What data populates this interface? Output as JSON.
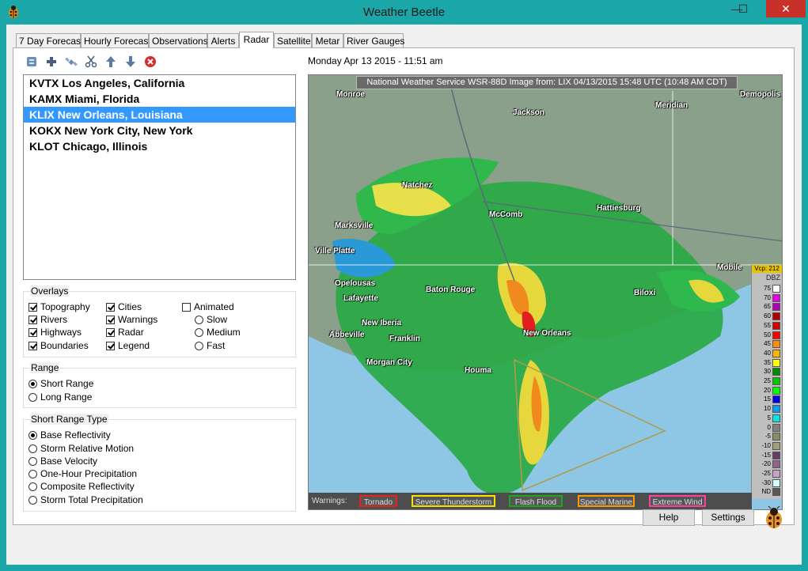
{
  "window": {
    "title": "Weather Beetle",
    "controls": {
      "minimize": "—",
      "maximize": "☐",
      "close": "✕"
    }
  },
  "tabs": [
    {
      "label": "7 Day Forecast"
    },
    {
      "label": "Hourly Forecast"
    },
    {
      "label": "Observations"
    },
    {
      "label": "Alerts"
    },
    {
      "label": "Radar"
    },
    {
      "label": "Satellite"
    },
    {
      "label": "Metar"
    },
    {
      "label": "River Gauges"
    }
  ],
  "active_tab": "Radar",
  "toolbar": [
    "refresh-icon",
    "add-icon",
    "satellite-icon",
    "cut-icon",
    "arrow-up-icon",
    "arrow-down-icon",
    "delete-icon"
  ],
  "stations": [
    {
      "label": "KVTX Los Angeles, California",
      "selected": false
    },
    {
      "label": "KAMX Miami, Florida",
      "selected": false
    },
    {
      "label": "KLIX New Orleans, Louisiana",
      "selected": true
    },
    {
      "label": "KOKX New York City, New York",
      "selected": false
    },
    {
      "label": "KLOT Chicago, Illinois",
      "selected": false
    }
  ],
  "overlays": {
    "title": "Overlays",
    "items": [
      {
        "label": "Topography",
        "checked": true
      },
      {
        "label": "Rivers",
        "checked": true
      },
      {
        "label": "Highways",
        "checked": true
      },
      {
        "label": "Boundaries",
        "checked": true
      },
      {
        "label": "Cities",
        "checked": true
      },
      {
        "label": "Warnings",
        "checked": true
      },
      {
        "label": "Radar",
        "checked": true
      },
      {
        "label": "Legend",
        "checked": true
      },
      {
        "label": "Animated",
        "checked": false
      }
    ],
    "speed": [
      {
        "label": "Slow",
        "checked": false
      },
      {
        "label": "Medium",
        "checked": false
      },
      {
        "label": "Fast",
        "checked": false
      }
    ]
  },
  "range": {
    "title": "Range",
    "options": [
      {
        "label": "Short Range",
        "checked": true
      },
      {
        "label": "Long Range",
        "checked": false
      }
    ]
  },
  "range_type": {
    "title": "Short Range Type",
    "options": [
      {
        "label": "Base Reflectivity",
        "checked": true
      },
      {
        "label": "Storm Relative Motion",
        "checked": false
      },
      {
        "label": "Base Velocity",
        "checked": false
      },
      {
        "label": "One-Hour Precipitation",
        "checked": false
      },
      {
        "label": "Composite Reflectivity",
        "checked": false
      },
      {
        "label": "Storm Total Precipitation",
        "checked": false
      }
    ]
  },
  "radar": {
    "timestamp": "Monday Apr 13 2015 - 11:51 am",
    "header": "National Weather Service WSR-88D Image from: LIX 04/13/2015 15:48 UTC (10:48 AM CDT)",
    "cities": [
      {
        "name": "Monroe"
      },
      {
        "name": "Jackson"
      },
      {
        "name": "Meridian"
      },
      {
        "name": "Demopolis"
      },
      {
        "name": "Natchez"
      },
      {
        "name": "McComb"
      },
      {
        "name": "Hattiesburg"
      },
      {
        "name": "Marksville"
      },
      {
        "name": "Ville Platte"
      },
      {
        "name": "Opelousas"
      },
      {
        "name": "Lafayette"
      },
      {
        "name": "Baton Rouge"
      },
      {
        "name": "Biloxi"
      },
      {
        "name": "Mobile"
      },
      {
        "name": "New Iberia"
      },
      {
        "name": "Abbeville"
      },
      {
        "name": "Franklin"
      },
      {
        "name": "Morgan City"
      },
      {
        "name": "New Orleans"
      },
      {
        "name": "Houma"
      }
    ],
    "legend": {
      "vcp": "Vcp: 212",
      "unit": "DBZ",
      "levels": [
        {
          "label": "75",
          "color": "#ffffff"
        },
        {
          "label": "70",
          "color": "#e600e6"
        },
        {
          "label": "65",
          "color": "#b400b4"
        },
        {
          "label": "60",
          "color": "#b40000"
        },
        {
          "label": "55",
          "color": "#d40000"
        },
        {
          "label": "50",
          "color": "#ff0000"
        },
        {
          "label": "45",
          "color": "#ff8c00"
        },
        {
          "label": "40",
          "color": "#ffb400"
        },
        {
          "label": "35",
          "color": "#ffff00"
        },
        {
          "label": "30",
          "color": "#008c00"
        },
        {
          "label": "25",
          "color": "#00c800"
        },
        {
          "label": "20",
          "color": "#00ff00"
        },
        {
          "label": "15",
          "color": "#0000f0"
        },
        {
          "label": "10",
          "color": "#009cf0"
        },
        {
          "label": "5",
          "color": "#00e6e6"
        },
        {
          "label": "0",
          "color": "#808080"
        },
        {
          "label": "-5",
          "color": "#8c8c64"
        },
        {
          "label": "-10",
          "color": "#a0a078"
        },
        {
          "label": "-15",
          "color": "#643c64"
        },
        {
          "label": "-20",
          "color": "#8c648c"
        },
        {
          "label": "-25",
          "color": "#c8a0c8"
        },
        {
          "label": "-30",
          "color": "#d2ffff"
        },
        {
          "label": "ND",
          "color": "#595959"
        }
      ]
    },
    "warnings_label": "Warnings:",
    "warnings": [
      {
        "label": "Tornado",
        "color": "#e32222"
      },
      {
        "label": "Severe Thunderstorm",
        "color": "#f2e300"
      },
      {
        "label": "Flash Flood",
        "color": "#1aa81a"
      },
      {
        "label": "Special Marine",
        "color": "#ff9a00"
      },
      {
        "label": "Extreme Wind",
        "color": "#ff3f9f"
      }
    ]
  },
  "buttons": {
    "help": "Help",
    "settings": "Settings"
  }
}
